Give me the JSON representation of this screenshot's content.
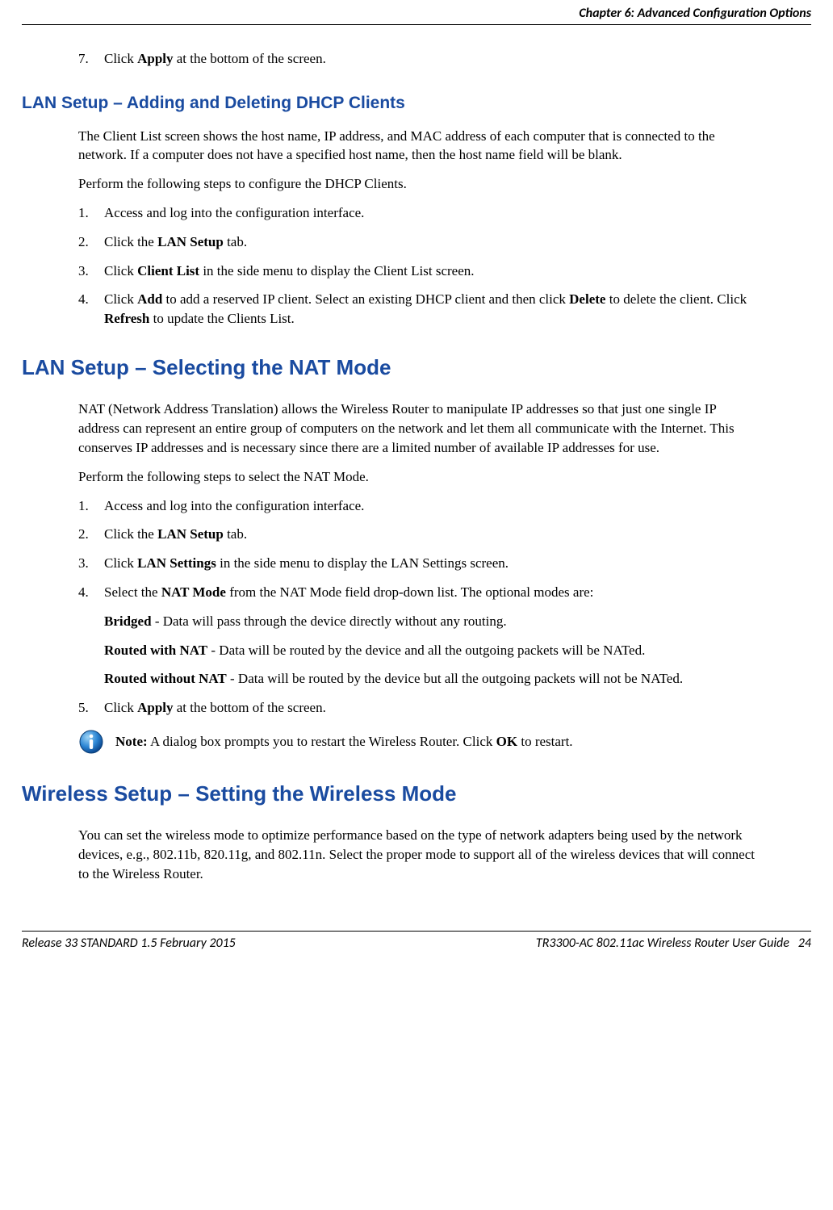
{
  "header": {
    "chapter": "Chapter 6: Advanced Configuration Options"
  },
  "intro_step": {
    "num": "7.",
    "text_prefix": "Click ",
    "bold": "Apply",
    "text_suffix": " at the bottom of the screen."
  },
  "section1": {
    "heading": "LAN Setup – Adding and Deleting DHCP Clients",
    "para1": "The Client List screen shows the host name, IP address, and MAC address of each computer that is connected to the network.  If a computer does not have a specified host name, then the host name field will be blank.",
    "para2": "Perform the following steps to configure the DHCP Clients.",
    "steps": {
      "s1": {
        "num": "1.",
        "text": "Access and log into the configuration interface."
      },
      "s2": {
        "num": "2.",
        "prefix": "Click the ",
        "bold": "LAN Setup",
        "suffix": " tab."
      },
      "s3": {
        "num": "3.",
        "prefix": "Click ",
        "bold": "Client List",
        "suffix": " in the side menu to display the Client List screen."
      },
      "s4": {
        "num": "4.",
        "p1": "Click ",
        "b1": "Add",
        "p2": " to add a reserved IP client.  Select an existing DHCP client and then click ",
        "b2": "Delete",
        "p3": " to delete the client.  Click ",
        "b3": "Refresh",
        "p4": " to update the Clients List."
      }
    }
  },
  "section2": {
    "heading": "LAN Setup – Selecting the NAT Mode",
    "para1": "NAT (Network Address Translation) allows the Wireless Router to manipulate IP addresses so that just one single IP address can represent an entire group of computers on the network and let them all communicate with the Internet.  This conserves IP addresses and is necessary since there are a limited number of available IP addresses for use.",
    "para2": "Perform the following steps to select the NAT Mode.",
    "steps": {
      "s1": {
        "num": "1.",
        "text": "Access and log into the configuration interface."
      },
      "s2": {
        "num": "2.",
        "prefix": "Click the ",
        "bold": "LAN Setup",
        "suffix": " tab."
      },
      "s3": {
        "num": "3.",
        "prefix": "Click ",
        "bold": "LAN Settings",
        "suffix": " in the side menu to display the LAN Settings screen."
      },
      "s4": {
        "num": "4.",
        "prefix": "Select the ",
        "bold": "NAT Mode",
        "suffix": " from the NAT Mode field drop-down list.  The optional modes are:"
      },
      "mode1": {
        "bold": "Bridged",
        "text": " - Data will pass through the device directly without any routing."
      },
      "mode2": {
        "bold": "Routed with NAT",
        "text": " - Data will be routed by the device and all the outgoing packets will be NATed."
      },
      "mode3": {
        "bold": "Routed without NAT",
        "text": " - Data will be routed by the device but all the outgoing packets will not be NATed."
      },
      "s5": {
        "num": "5.",
        "prefix": "Click ",
        "bold": "Apply",
        "suffix": " at the bottom of the screen."
      }
    },
    "note": {
      "label": "Note:",
      "text1": "  A dialog box prompts you to restart the Wireless Router. Click ",
      "bold": "OK",
      "text2": " to restart."
    }
  },
  "section3": {
    "heading": "Wireless Setup – Setting the Wireless Mode",
    "para1": "You can set the wireless mode to optimize performance based on the type of network adapters being used by the network devices, e.g., 802.11b, 820.11g, and 802.11n.  Select the proper mode to support all of the wireless devices that will connect to the Wireless Router."
  },
  "footer": {
    "left": "Release 33 STANDARD 1.5    February 2015",
    "right_title": "TR3300-AC 802.11ac Wireless Router User Guide",
    "right_page": "24"
  }
}
